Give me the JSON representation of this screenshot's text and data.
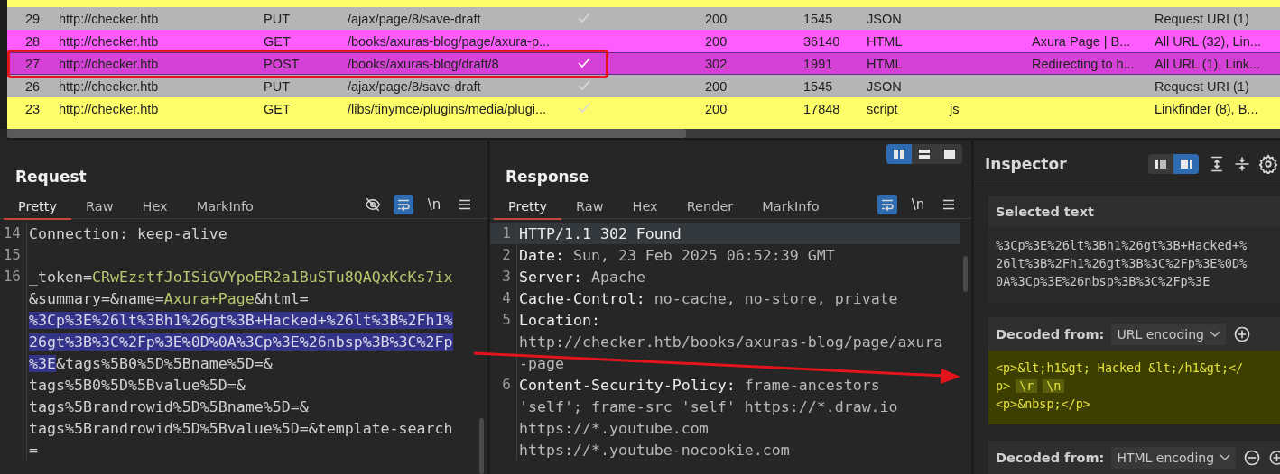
{
  "table": {
    "rows": [
      {
        "id": "29",
        "host": "http://checker.htb",
        "method": "PUT",
        "url": "/ajax/page/8/save-draft",
        "edited": true,
        "status": "200",
        "length": "1545",
        "mime": "JSON",
        "ext": "",
        "title": "",
        "notes": "Request URI (1)",
        "color": "#b5b5b5",
        "selected": false
      },
      {
        "id": "28",
        "host": "http://checker.htb",
        "method": "GET",
        "url": "/books/axuras-blog/page/axura-p...",
        "edited": false,
        "status": "200",
        "length": "36140",
        "mime": "HTML",
        "ext": "",
        "title": "Axura Page | B...",
        "notes": "All URL (32), Lin...",
        "color": "#ff5cff",
        "selected": false
      },
      {
        "id": "27",
        "host": "http://checker.htb",
        "method": "POST",
        "url": "/books/axuras-blog/draft/8",
        "edited": true,
        "status": "302",
        "length": "1991",
        "mime": "HTML",
        "ext": "",
        "title": "Redirecting to h...",
        "notes": "All URL (1), Link...",
        "color": "#d541d6",
        "selected": true
      },
      {
        "id": "26",
        "host": "http://checker.htb",
        "method": "PUT",
        "url": "/ajax/page/8/save-draft",
        "edited": true,
        "status": "200",
        "length": "1545",
        "mime": "JSON",
        "ext": "",
        "title": "",
        "notes": "Request URI (1)",
        "color": "#b5b5b5",
        "selected": false
      },
      {
        "id": "23",
        "host": "http://checker.htb",
        "method": "GET",
        "url": "/libs/tinymce/plugins/media/plugi...",
        "edited": true,
        "status": "200",
        "length": "17848",
        "mime": "script",
        "ext": "js",
        "title": "",
        "notes": "Linkfinder (8), B...",
        "color": "#fdfd6a",
        "selected": false
      }
    ]
  },
  "request": {
    "title": "Request",
    "tabs": [
      {
        "label": "Pretty",
        "selected": true
      },
      {
        "label": "Raw",
        "selected": false
      },
      {
        "label": "Hex",
        "selected": false
      },
      {
        "label": "MarkInfo",
        "selected": false
      }
    ],
    "newline_label": "\\n",
    "lines": [
      {
        "number": "14",
        "parts": [
          {
            "kind": "plain",
            "text": "Connection: keep-alive"
          }
        ]
      },
      {
        "number": "15"
      },
      {
        "number": "16",
        "parts": [
          {
            "kind": "plain",
            "text": "_token="
          },
          {
            "kind": "value",
            "text": "CRwEzstfJoISiGVYpoER2a1BuSTu8QAQxKcKs7ix"
          }
        ]
      },
      {
        "parts": [
          {
            "kind": "plain",
            "text": "&summary=&name="
          },
          {
            "kind": "value",
            "text": "Axura+Page"
          },
          {
            "kind": "plain",
            "text": "&html="
          }
        ]
      },
      {
        "parts": [
          {
            "kind": "selected",
            "text": "%3Cp%3E%26lt%3Bh1%26gt%3B+Hacked+%26lt%3B%2Fh1%"
          }
        ]
      },
      {
        "parts": [
          {
            "kind": "selected",
            "text": "26gt%3B%3C%2Fp%3E%0D%0A%3Cp%3E%26nbsp%3B%3C%2Fp"
          }
        ]
      },
      {
        "parts": [
          {
            "kind": "selected",
            "text": "%3E"
          },
          {
            "kind": "plain",
            "text": "&tags%5B0%5D%5Bname%5D=&"
          }
        ]
      },
      {
        "parts": [
          {
            "kind": "plain",
            "text": "tags%5B0%5D%5Bvalue%5D=&"
          }
        ]
      },
      {
        "parts": [
          {
            "kind": "plain",
            "text": "tags%5Brandrowid%5D%5Bname%5D=&"
          }
        ]
      },
      {
        "parts": [
          {
            "kind": "plain",
            "text": "tags%5Brandrowid%5D%5Bvalue%5D=&template-search"
          }
        ]
      },
      {
        "parts": [
          {
            "kind": "plain",
            "text": "="
          }
        ]
      }
    ]
  },
  "response": {
    "title": "Response",
    "tabs": [
      {
        "label": "Pretty",
        "selected": true
      },
      {
        "label": "Raw",
        "selected": false
      },
      {
        "label": "Hex",
        "selected": false
      },
      {
        "label": "Render",
        "selected": false
      },
      {
        "label": "MarkInfo",
        "selected": false
      }
    ],
    "newline_label": "\\n",
    "layouts": [
      {
        "selected": true
      },
      {
        "selected": false
      },
      {
        "selected": false
      }
    ],
    "lines": [
      {
        "number": "1",
        "current": true,
        "parts": [
          {
            "kind": "key",
            "text": "HTTP/1.1 302 Found"
          }
        ]
      },
      {
        "number": "2",
        "current": false,
        "parts": [
          {
            "kind": "key",
            "text": "Date:"
          },
          {
            "kind": "plain",
            "text": " Sun, 23 Feb 2025 06:52:39 GMT"
          }
        ]
      },
      {
        "number": "3",
        "current": false,
        "parts": [
          {
            "kind": "key",
            "text": "Server:"
          },
          {
            "kind": "plain",
            "text": " Apache"
          }
        ]
      },
      {
        "number": "4",
        "current": false,
        "parts": [
          {
            "kind": "key",
            "text": "Cache-Control:"
          },
          {
            "kind": "plain",
            "text": " no-cache, no-store, private"
          }
        ]
      },
      {
        "number": "5",
        "current": false,
        "parts": [
          {
            "kind": "key",
            "text": "Location:"
          }
        ]
      },
      {
        "current": false,
        "parts": [
          {
            "kind": "plain",
            "text": "http://checker.htb/books/axuras-blog/page/axura"
          }
        ]
      },
      {
        "current": false,
        "parts": [
          {
            "kind": "plain",
            "text": "-page"
          }
        ]
      },
      {
        "number": "6",
        "current": false,
        "parts": [
          {
            "kind": "key",
            "text": "Content-Security-Policy:"
          },
          {
            "kind": "plain",
            "text": " frame-ancestors"
          }
        ]
      },
      {
        "current": false,
        "parts": [
          {
            "kind": "plain",
            "text": "'self'; frame-src 'self' https://*.draw.io"
          }
        ]
      },
      {
        "current": false,
        "parts": [
          {
            "kind": "plain",
            "text": "https://*.youtube.com"
          }
        ]
      },
      {
        "current": false,
        "parts": [
          {
            "kind": "plain",
            "text": "https://*.youtube-nocookie.com"
          }
        ]
      }
    ]
  },
  "inspector": {
    "title": "Inspector",
    "layouts": [
      {
        "selected": false
      },
      {
        "selected": true
      }
    ],
    "selected_text": {
      "label": "Selected text",
      "lines": [
        "%3Cp%3E%26lt%3Bh1%26gt%3B+Hacked+%",
        "26lt%3B%2Fh1%26gt%3B%3C%2Fp%3E%0D%",
        "0A%3Cp%3E%26nbsp%3B%3C%2Fp%3E"
      ]
    },
    "decoders": [
      {
        "label": "Decoded from:",
        "encoding": "URL encoding",
        "removable": false,
        "lines": [
          [
            {
              "kind": "text",
              "text": "<p>&lt;h1&gt; Hacked &lt;/h1&gt;</"
            }
          ],
          [
            {
              "kind": "text",
              "text": "p>"
            },
            {
              "kind": "escape",
              "text": "\\r"
            },
            {
              "kind": "escape",
              "text": "\\n"
            }
          ],
          [
            {
              "kind": "text",
              "text": "<p>&nbsp;</p>"
            }
          ]
        ]
      },
      {
        "label": "Decoded from:",
        "encoding": "HTML encoding",
        "removable": true
      }
    ]
  }
}
